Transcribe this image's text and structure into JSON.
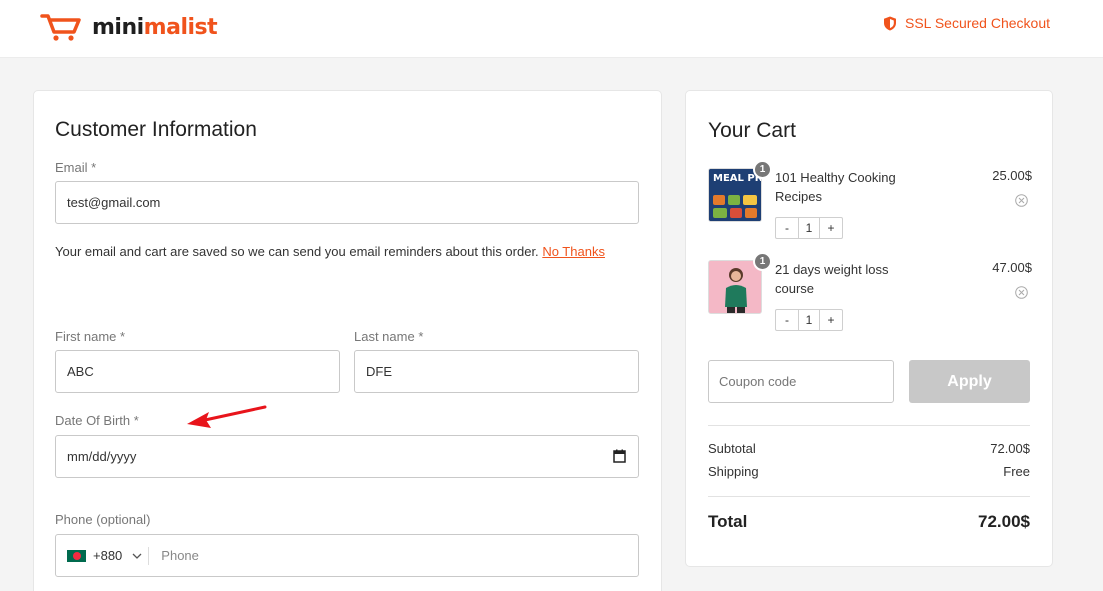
{
  "brand": {
    "logo_part1": "mini",
    "logo_part2": "malist",
    "accent": "#f0531c"
  },
  "header": {
    "secure_label": "SSL Secured Checkout",
    "secure_icon": "shield-icon"
  },
  "customer": {
    "title": "Customer Information",
    "email_label": "Email *",
    "email_value": "test@gmail.com",
    "email_note": "Your email and cart are saved so we can send you email reminders about this order.",
    "no_thanks": "No Thanks",
    "first_name_label": "First name *",
    "first_name_value": "ABC",
    "last_name_label": "Last name *",
    "last_name_value": "DFE",
    "dob_label": "Date Of Birth *",
    "dob_placeholder": "mm/dd/yyyy",
    "phone_label": "Phone (optional)",
    "phone_code": "+880",
    "phone_placeholder": "Phone"
  },
  "cart": {
    "title": "Your Cart",
    "items": [
      {
        "name": "101 Healthy Cooking Recipes",
        "price": "25.00$",
        "qty": "1",
        "badge": "1",
        "thumb_text": "MEAL PREP"
      },
      {
        "name": "21 days weight loss course",
        "price": "47.00$",
        "qty": "1",
        "badge": "1"
      }
    ],
    "qty_minus": "-",
    "qty_plus": "+",
    "coupon_placeholder": "Coupon code",
    "apply_label": "Apply",
    "subtotal_label": "Subtotal",
    "subtotal_value": "72.00$",
    "shipping_label": "Shipping",
    "shipping_value": "Free",
    "total_label": "Total",
    "total_value": "72.00$"
  }
}
